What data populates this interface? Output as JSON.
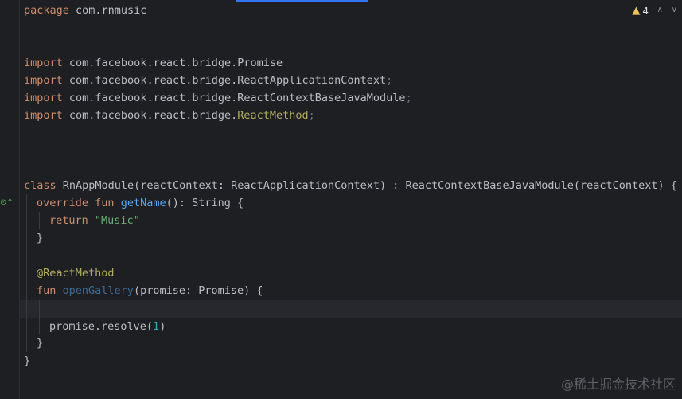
{
  "status": {
    "warning_icon": "warning-triangle-icon",
    "warning_count": "4",
    "up_arrow": "∧",
    "down_arrow": "∨"
  },
  "code": {
    "package_kw": "package",
    "package_name": " com.rnmusic",
    "imports": [
      {
        "kw": "import",
        "path": " com.facebook.react.bridge.Promise",
        "tail": ""
      },
      {
        "kw": "import",
        "path": " com.facebook.react.bridge.ReactApplicationContext",
        "tail": ";"
      },
      {
        "kw": "import",
        "path": " com.facebook.react.bridge.ReactContextBaseJavaModule",
        "tail": ";"
      },
      {
        "kw": "import",
        "path": " com.facebook.react.bridge.",
        "annot": "ReactMethod",
        "tail": ";"
      }
    ],
    "class_kw": "class",
    "class_sig": " RnAppModule(reactContext: ReactApplicationContext) : ReactContextBaseJavaModule(reactContext) {",
    "override_kw": "override fun",
    "getname_fn": "getName",
    "getname_sig": "(): String {",
    "return_kw": "return",
    "music_str": "\"Music\"",
    "close_brace": "}",
    "annotation": "@ReactMethod",
    "fun_kw": "fun",
    "opengallery_fn": "openGallery",
    "opengallery_sig": "(promise: Promise) {",
    "resolve_call": "promise.resolve(",
    "resolve_arg": "1",
    "resolve_close": ")"
  },
  "watermark": "@稀土掘金技术社区"
}
